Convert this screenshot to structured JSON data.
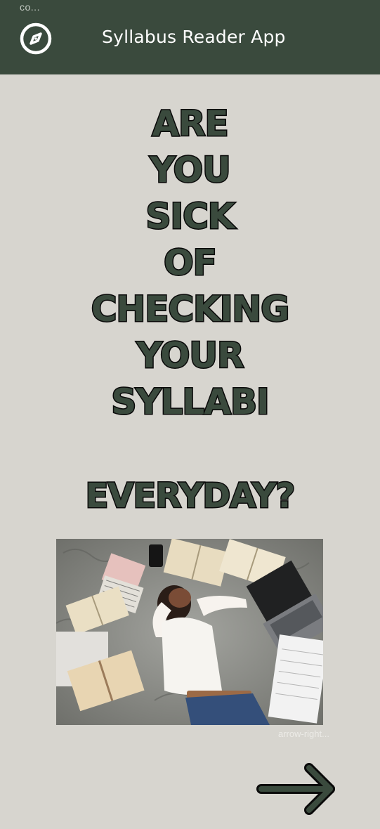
{
  "status_bar": {
    "text": "co..."
  },
  "header": {
    "title": "Syllabus Reader App",
    "icon": "compass-icon",
    "background": "#3a4a3d"
  },
  "headline": {
    "lines": [
      "ARE",
      "YOU",
      "SICK",
      "OF",
      "CHECKING",
      "YOUR",
      "SYLLABI"
    ],
    "last_line": "EVERYDAY?",
    "fill_color": "#3a4a3d",
    "outline_color": "#0b0b0b"
  },
  "illustration": {
    "icon": "student-overwhelmed-image"
  },
  "navigation": {
    "arrow_label": "arrow-right...",
    "arrow_icon": "arrow-right-icon"
  },
  "colors": {
    "background": "#d7d5cf",
    "accent": "#3a4a3d"
  }
}
